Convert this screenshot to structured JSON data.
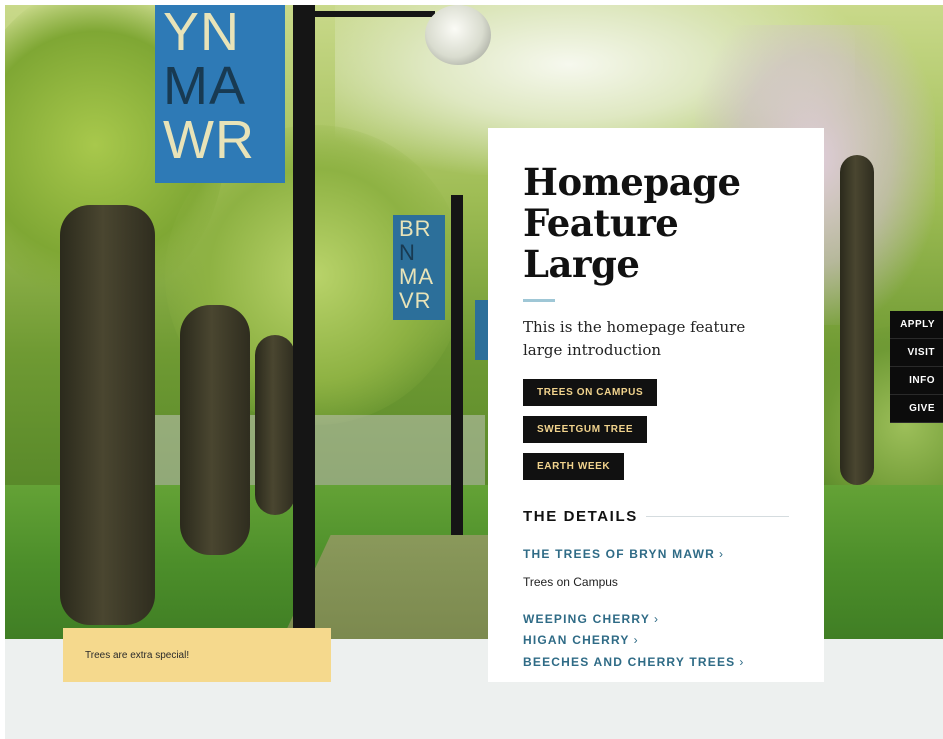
{
  "hero": {
    "banner_large_lines": [
      "YN",
      "MA",
      "WR"
    ],
    "banner_small_lines": [
      "BR",
      "N",
      "MA",
      "VR"
    ]
  },
  "feature": {
    "title_line1": "Homepage",
    "title_line2": "Feature Large",
    "intro": "This is the homepage feature large introduction",
    "tags": [
      "TREES ON CAMPUS",
      "SWEETGUM TREE",
      "EARTH WEEK"
    ]
  },
  "details": {
    "heading": "THE DETAILS",
    "primary_link": "THE TREES OF BRYN MAWR",
    "primary_text": "Trees on Campus",
    "links": [
      "WEEPING CHERRY",
      "HIGAN CHERRY",
      "BEECHES AND CHERRY TREES"
    ],
    "chevron": "›"
  },
  "caption": {
    "text": "Trees are extra special!"
  },
  "quick_links": [
    "APPLY",
    "VISIT",
    "INFO",
    "GIVE"
  ],
  "colors": {
    "banner_blue": "#2e7ab6",
    "tag_background": "#111111",
    "tag_text": "#f1d38d",
    "link_teal": "#2f6b86",
    "caption_yellow": "#f5d98d"
  }
}
